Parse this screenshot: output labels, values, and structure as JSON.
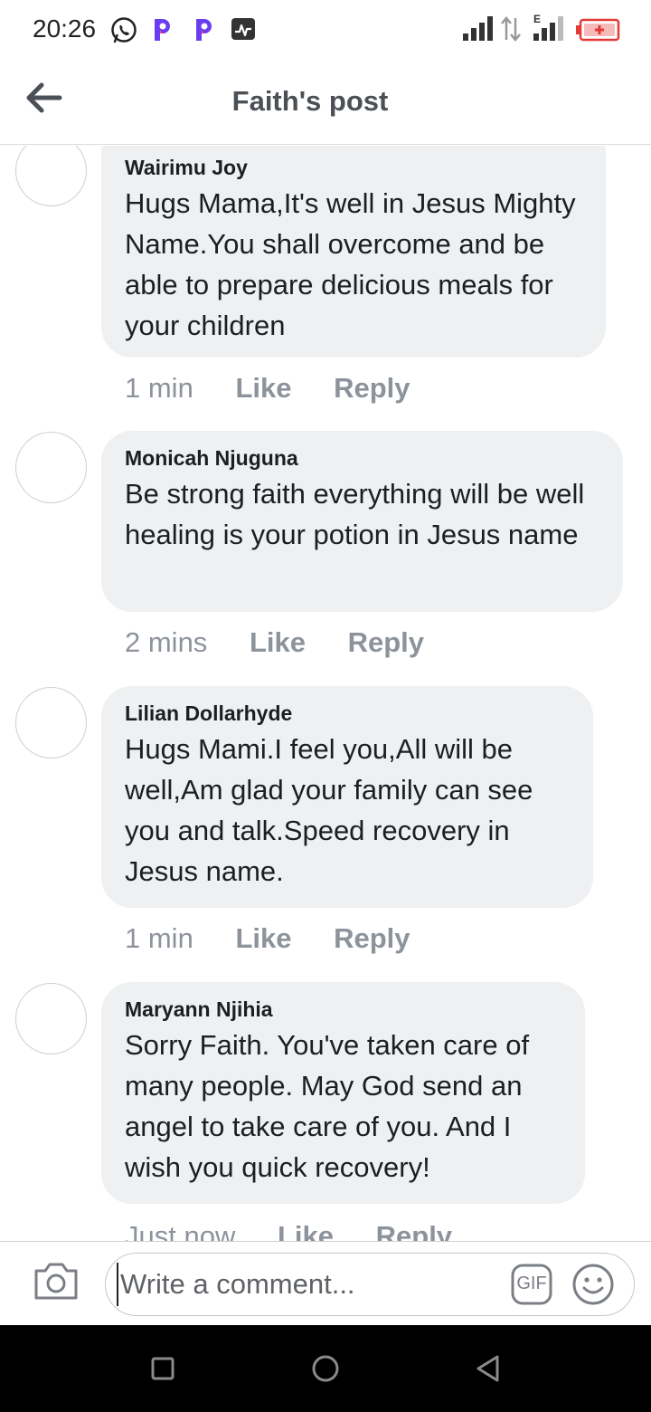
{
  "status_bar": {
    "time": "20:26",
    "notification_icons": [
      "whatsapp-icon",
      "p-app-icon",
      "p-app-icon",
      "activity-icon"
    ],
    "right_icons": [
      "signal-icon",
      "data-arrows-icon",
      "signal-e-icon",
      "battery-low-icon"
    ],
    "battery_color": "#e53935",
    "network_label": "E"
  },
  "header": {
    "title": "Faith's post",
    "back_icon": "arrow-left-icon"
  },
  "comments": [
    {
      "author": "Wairimu Joy",
      "text": "Hugs Mama,It's well in Jesus Mighty Name.You shall overcome and be able to prepare delicious meals for your children",
      "time": "1 min",
      "like": "Like",
      "reply": "Reply"
    },
    {
      "author": "Monicah Njuguna",
      "text": "Be strong faith everything will be well healing is your potion in Jesus name",
      "time": "2 mins",
      "like": "Like",
      "reply": "Reply"
    },
    {
      "author": "Lilian Dollarhyde",
      "text": "Hugs Mami.I feel you,All will be well,Am glad your family can see you and talk.Speed recovery in Jesus name.",
      "time": "1 min",
      "like": "Like",
      "reply": "Reply"
    },
    {
      "author": "Maryann Njihia",
      "text": "Sorry Faith. You've taken care of many people. May God send an angel to take care of you. And I wish you quick recovery!",
      "time": "Just now",
      "like": "Like",
      "reply": "Reply"
    }
  ],
  "composer": {
    "placeholder": "Write a comment...",
    "camera_icon": "camera-icon",
    "gif_label": "GIF",
    "emoji_icon": "smiley-icon"
  },
  "nav_bar": {
    "buttons": [
      "square-recents-icon",
      "circle-home-icon",
      "triangle-back-icon"
    ]
  },
  "colors": {
    "bubble": "#eff0f2",
    "secondary_text": "#8d939b",
    "title_text": "#4b4f56"
  }
}
